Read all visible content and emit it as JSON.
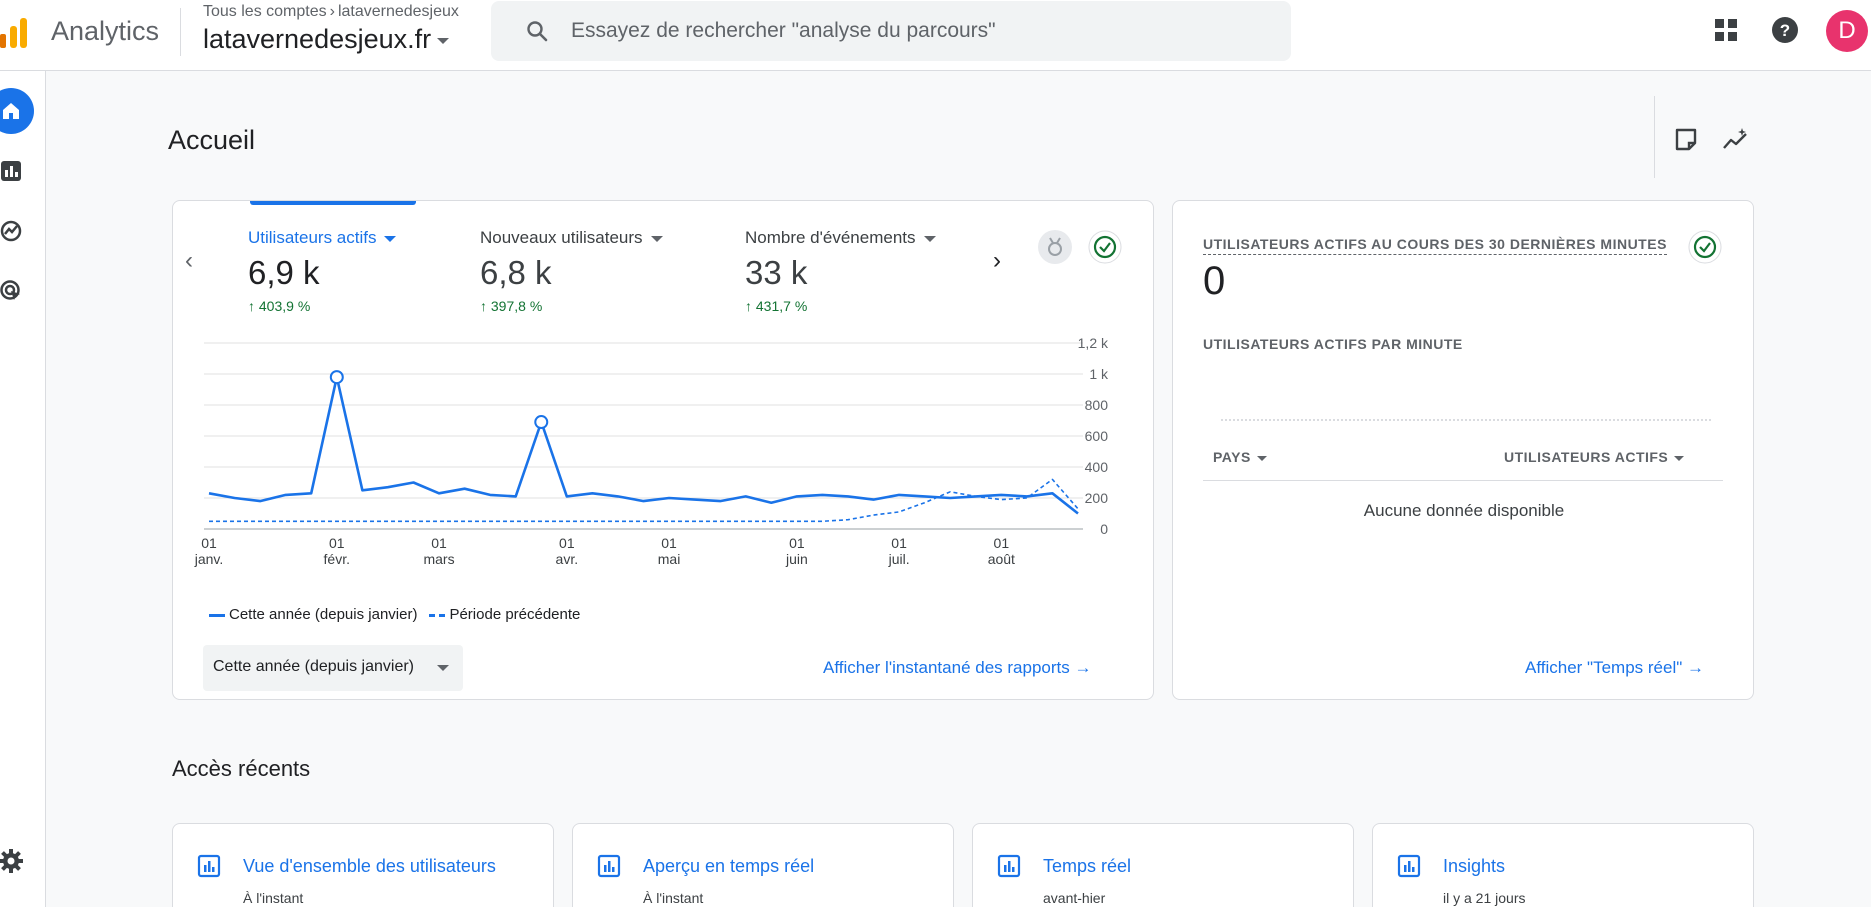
{
  "app": {
    "title": "Analytics"
  },
  "breadcrumb": {
    "account": "Tous les comptes",
    "property_parent": "latavernedesjeux"
  },
  "property": {
    "name": "latavernedesjeux.fr"
  },
  "search": {
    "placeholder": "Essayez de rechercher \"analyse du parcours\""
  },
  "header": {
    "avatar_letter": "D"
  },
  "page": {
    "title": "Accueil"
  },
  "metrics": [
    {
      "label": "Utilisateurs actifs",
      "value": "6,9 k",
      "delta": "403,9 %"
    },
    {
      "label": "Nouveaux utilisateurs",
      "value": "6,8 k",
      "delta": "397,8 %"
    },
    {
      "label": "Nombre d'événements",
      "value": "33 k",
      "delta": "431,7 %"
    }
  ],
  "legend": {
    "current": "Cette année (depuis janvier)",
    "previous": "Période précédente"
  },
  "date_range": {
    "selected": "Cette année (depuis janvier)"
  },
  "links": {
    "reports_snapshot": "Afficher l'instantané des rapports",
    "realtime": "Afficher \"Temps réel\""
  },
  "realtime": {
    "title": "UTILISATEURS ACTIFS AU COURS DES 30 DERNIÈRES MINUTES",
    "value": "0",
    "per_minute_title": "UTILISATEURS ACTIFS PAR MINUTE",
    "col_country": "PAYS",
    "col_users": "UTILISATEURS ACTIFS",
    "empty": "Aucune donnée disponible"
  },
  "recent": {
    "title": "Accès récents",
    "items": [
      {
        "title": "Vue d'ensemble des utilisateurs",
        "time": "À l'instant"
      },
      {
        "title": "Aperçu en temps réel",
        "time": "À l'instant"
      },
      {
        "title": "Temps réel",
        "time": "avant-hier"
      },
      {
        "title": "Insights",
        "time": "il y a 21 jours"
      }
    ]
  },
  "colors": {
    "accent": "#1a73e8",
    "positive": "#137333",
    "avatar": "#e8336d"
  },
  "chart_data": {
    "type": "line",
    "ylim": [
      0,
      1200
    ],
    "yticks": [
      "0",
      "200",
      "400",
      "600",
      "800",
      "1 k",
      "1,2 k"
    ],
    "ytick_values": [
      0,
      200,
      400,
      600,
      800,
      1000,
      1200
    ],
    "xticks": [
      {
        "day": "01",
        "month": "janv.",
        "index": 0
      },
      {
        "day": "01",
        "month": "févr.",
        "index": 5
      },
      {
        "day": "01",
        "month": "mars",
        "index": 9
      },
      {
        "day": "01",
        "month": "avr.",
        "index": 14
      },
      {
        "day": "01",
        "month": "mai",
        "index": 18
      },
      {
        "day": "01",
        "month": "juin",
        "index": 23
      },
      {
        "day": "01",
        "month": "juil.",
        "index": 27
      },
      {
        "day": "01",
        "month": "août",
        "index": 31
      }
    ],
    "series": [
      {
        "name": "Cette année (depuis janvier)",
        "style": "solid",
        "values": [
          230,
          200,
          180,
          220,
          230,
          980,
          250,
          270,
          300,
          230,
          260,
          220,
          210,
          690,
          210,
          230,
          210,
          180,
          200,
          190,
          180,
          210,
          170,
          210,
          220,
          210,
          190,
          220,
          210,
          200,
          210,
          220,
          210,
          230,
          100
        ],
        "markers": [
          5,
          13
        ]
      },
      {
        "name": "Période précédente",
        "style": "dashed",
        "values": [
          50,
          50,
          50,
          50,
          50,
          50,
          50,
          50,
          50,
          50,
          50,
          50,
          50,
          50,
          50,
          50,
          50,
          50,
          50,
          50,
          50,
          50,
          50,
          50,
          50,
          60,
          90,
          110,
          170,
          240,
          210,
          190,
          200,
          320,
          130
        ]
      }
    ]
  }
}
